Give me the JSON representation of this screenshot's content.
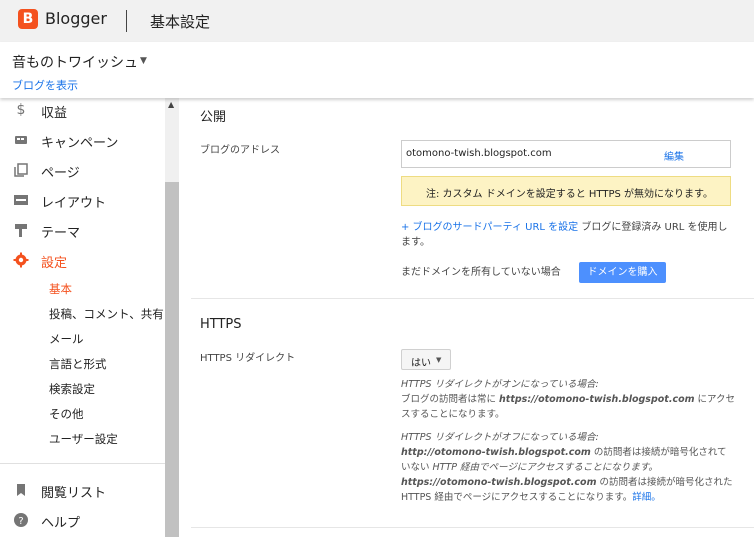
{
  "topbar": {
    "logo_letter": "B",
    "brand": "Blogger",
    "page_title": "基本設定"
  },
  "blog": {
    "name": "音ものトワイッシュ",
    "view_link": "ブログを表示"
  },
  "sidebar": {
    "items": [
      {
        "icon": "dollar-icon",
        "label": "収益"
      },
      {
        "icon": "campaign-icon",
        "label": "キャンペーン"
      },
      {
        "icon": "pages-icon",
        "label": "ページ"
      },
      {
        "icon": "layout-icon",
        "label": "レイアウト"
      },
      {
        "icon": "theme-icon",
        "label": "テーマ"
      },
      {
        "icon": "gear-icon",
        "label": "設定"
      }
    ],
    "sub_items": [
      "基本",
      "投稿、コメント、共有",
      "メール",
      "言語と形式",
      "検索設定",
      "その他",
      "ユーザー設定"
    ],
    "bottom_items": [
      {
        "icon": "bookmark-icon",
        "label": "閲覧リスト"
      },
      {
        "icon": "help-icon",
        "label": "ヘルプ"
      }
    ]
  },
  "publish": {
    "title": "公開",
    "address_label": "ブログのアドレス",
    "address_value": "otomono-twish.blogspot.com",
    "edit": "編集",
    "warning": "注: カスタム ドメインを設定すると HTTPS が無効になります。",
    "third_party_link": "+ ブログのサードパーティ URL を設定",
    "third_party_rest": " ブログに登録済み URL を使用します。",
    "no_domain": "まだドメインを所有していない場合",
    "buy_button": "ドメインを購入"
  },
  "https": {
    "title": "HTTPS",
    "redirect_label": "HTTPS リダイレクト",
    "select_value": "はい",
    "on_line1": "HTTPS リダイレクトがオンになっている場合:",
    "on_line2a": "ブログの訪問者は常に ",
    "on_url": "https://otomono-twish.blogspot.com",
    "on_line2b": " にアクセスすることになります。",
    "off_line1": "HTTPS リダイレクトがオフになっている場合:",
    "off_url1": "http://otomono-twish.blogspot.com",
    "off_text1": " の訪問者は接続が暗号化されていない ",
    "off_text1b": "HTTP 経由でページにアクセスすることになります。",
    "off_url2": "https://otomono-twish.blogspot.com",
    "off_text2": " の訪問者は接続が暗号化された ",
    "off_text2b": "HTTPS 経由でページにアクセスすることになります。",
    "details_link": "詳細。"
  }
}
